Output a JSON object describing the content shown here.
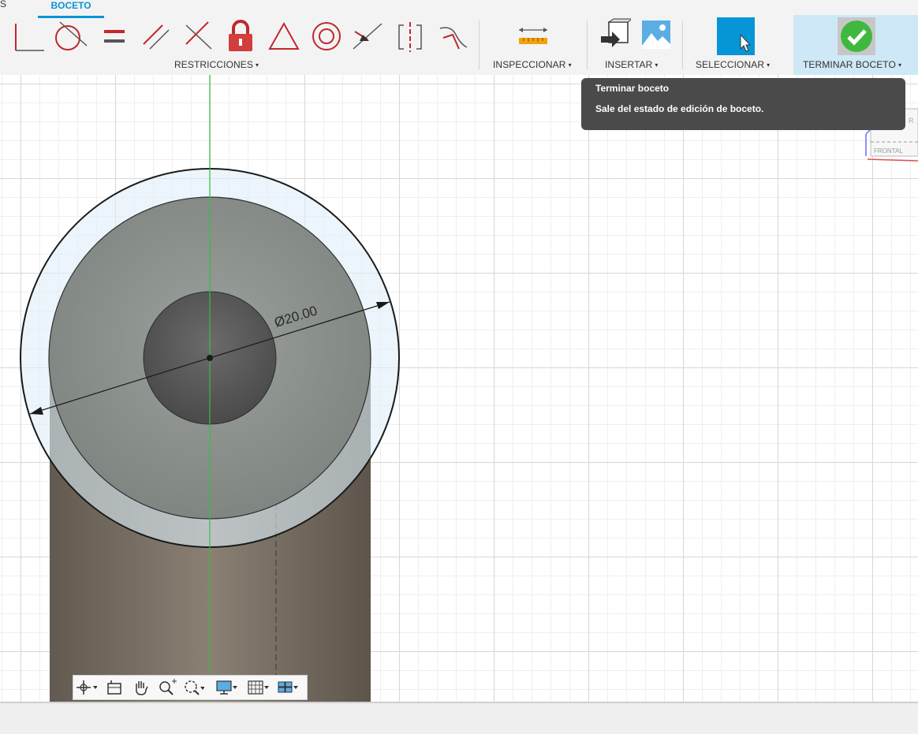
{
  "tabs": {
    "cut_label": "S",
    "active_label": "BOCETO"
  },
  "toolbar": {
    "groups": {
      "restricciones": "RESTRICCIONES",
      "inspeccionar": "INSPECCIONAR",
      "insertar": "INSERTAR",
      "seleccionar": "SELECCIONAR",
      "terminar": "TERMINAR BOCETO"
    },
    "caret": "▾"
  },
  "tooltip": {
    "title": "Terminar boceto",
    "body": "Sale del estado de edición de boceto."
  },
  "sketch": {
    "dimension_label": "Ø20.00"
  },
  "viewcube": {
    "face_label": "FRONTAL",
    "side_label": "R"
  },
  "colors": {
    "accent": "#0696d7",
    "constraint_red": "#c1272d",
    "finish_green": "#3fb83f",
    "axis_green": "#3dbb3d"
  }
}
